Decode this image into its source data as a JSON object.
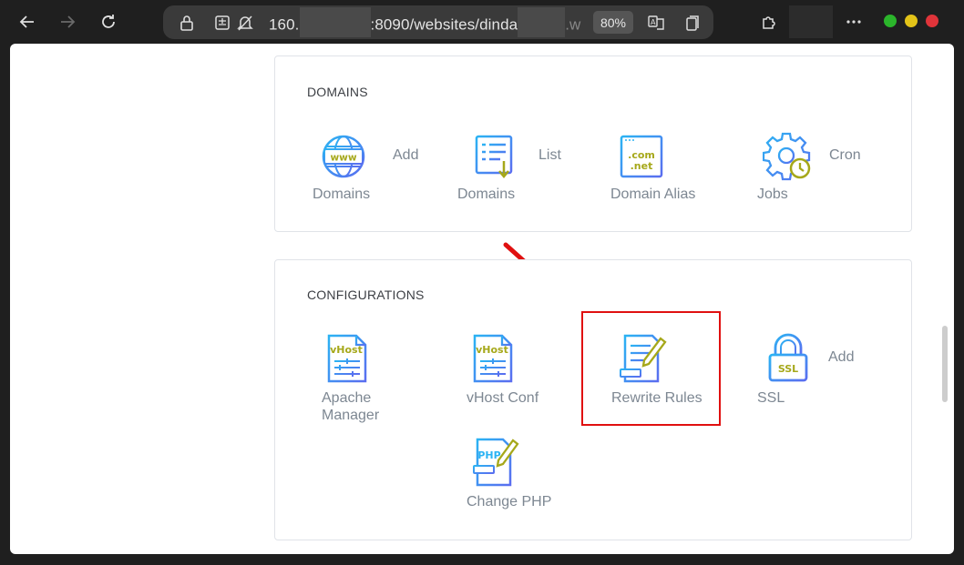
{
  "browser": {
    "url_start": "160.",
    "url_middle": ":8090/websites/dinda",
    "url_end": ".w",
    "zoom": "80%"
  },
  "domains": {
    "title": "DOMAINS",
    "items": [
      {
        "line1": "Domains",
        "side": "Add",
        "icon": "www-globe-icon"
      },
      {
        "line1": "Domains",
        "side": "List",
        "icon": "list-download-icon"
      },
      {
        "line1": "Domain Alias",
        "side": "",
        "icon": "com-net-icon"
      },
      {
        "line1": "Jobs",
        "side": "Cron",
        "icon": "gear-clock-icon"
      }
    ]
  },
  "configurations": {
    "title": "CONFIGURATIONS",
    "items": [
      {
        "line1": "Apache",
        "line2": "Manager",
        "side": "",
        "icon": "vhost-file-icon"
      },
      {
        "line1": "vHost Conf",
        "line2": "",
        "side": "",
        "icon": "vhost-file-icon"
      },
      {
        "line1": "Rewrite Rules",
        "line2": "",
        "side": "",
        "icon": "document-pencil-icon"
      },
      {
        "line1": "SSL",
        "line2": "",
        "side": "Add",
        "icon": "ssl-lock-icon"
      },
      {
        "line1": "Change PHP",
        "line2": "",
        "side": "",
        "icon": "php-pencil-icon"
      }
    ]
  },
  "colors": {
    "accent_blue": "#2196f3",
    "accent_olive": "#a6a81a",
    "annotation_red": "#e01010"
  }
}
